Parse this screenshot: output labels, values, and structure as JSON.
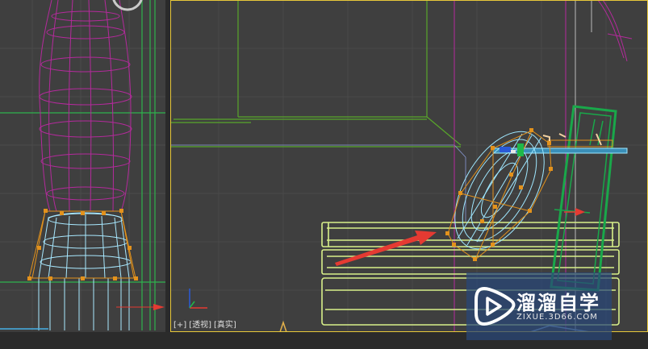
{
  "viewport_left": {
    "name": "left-viewport"
  },
  "viewport_right": {
    "label_parts": [
      "[+]",
      "[透视]",
      "[真实]"
    ],
    "active": true
  },
  "watermark": {
    "title": "溜溜自学",
    "subtitle": "ZIXUE.3D66.COM"
  },
  "colors": {
    "viewport_bg": "#3f3f3f",
    "grid": "#4a4a4a",
    "wire_yellowgreen": "#d8f08a",
    "wire_green": "#19a84a",
    "wire_magenta": "#b42a9c",
    "wire_cyan": "#9fe7ff",
    "wire_orange": "#e3921c",
    "arrow_red": "#e53a32",
    "active_border": "#e8c83a",
    "watermark_bg": "#2c4c7c"
  }
}
